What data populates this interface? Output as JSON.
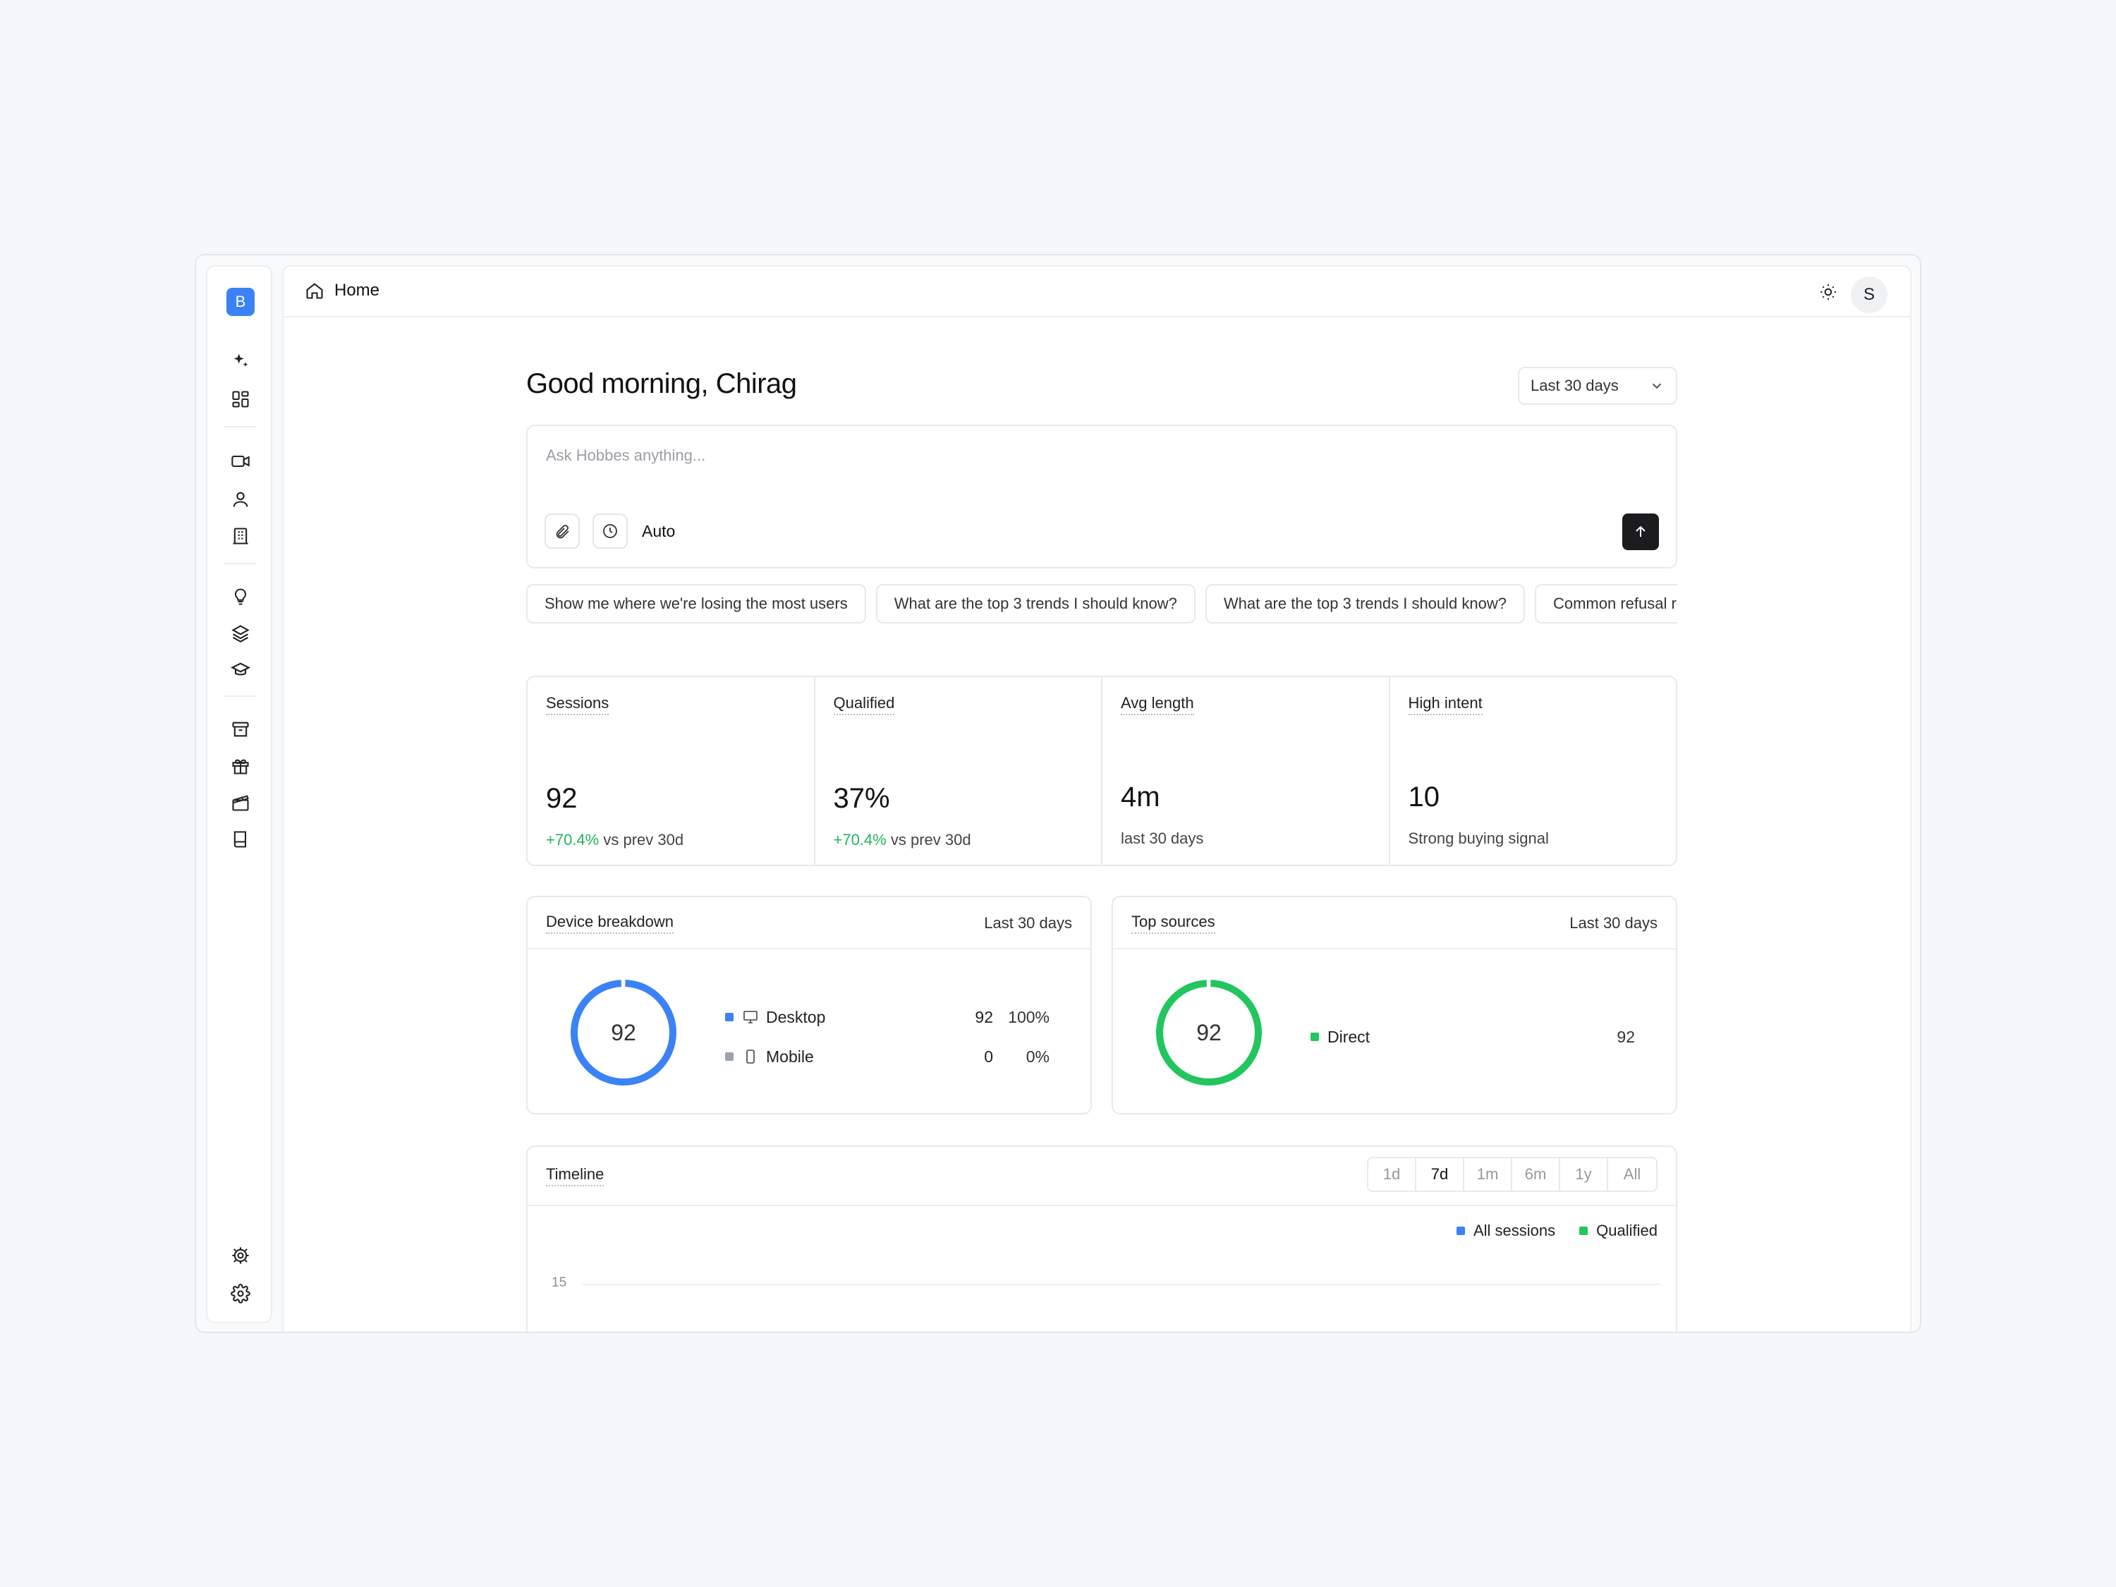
{
  "app": {
    "logo_letter": "B",
    "breadcrumb": "Home",
    "avatar_initial": "S"
  },
  "sidebar": {
    "icons": [
      "sparkles-icon",
      "dashboard-icon",
      "video-icon",
      "user-icon",
      "building-icon",
      "lightbulb-icon",
      "layers-icon",
      "graduation-cap-icon",
      "archive-icon",
      "gift-icon",
      "clapperboard-icon",
      "book-icon",
      "settings-gear-icon",
      "settings-icon"
    ]
  },
  "header": {
    "greeting": "Good morning, Chirag",
    "range_select": "Last 30 days"
  },
  "ask": {
    "placeholder": "Ask Hobbes anything...",
    "mode": "Auto"
  },
  "suggestions": [
    "Show me where we're losing the most users",
    "What are the top 3 trends I should know?",
    "What are the top 3 trends I should know?",
    "Common refusal reasons"
  ],
  "stats": [
    {
      "label": "Sessions",
      "value": "92",
      "delta": "+70.4%",
      "sub": " vs prev 30d"
    },
    {
      "label": "Qualified",
      "value": "37%",
      "delta": "+70.4%",
      "sub": " vs prev 30d"
    },
    {
      "label": "Avg length",
      "value": "4m",
      "delta": "",
      "sub": "last 30 days"
    },
    {
      "label": "High intent",
      "value": "10",
      "delta": "",
      "sub": "Strong buying signal"
    }
  ],
  "device_breakdown": {
    "title": "Device breakdown",
    "range": "Last 30 days",
    "total": "92",
    "accent": "#3b82f6",
    "rows": [
      {
        "name": "Desktop",
        "count": "92",
        "pct": "100%",
        "color": "#3b82f6"
      },
      {
        "name": "Mobile",
        "count": "0",
        "pct": "0%",
        "color": "#9ca3af"
      }
    ]
  },
  "top_sources": {
    "title": "Top sources",
    "range": "Last 30 days",
    "total": "92",
    "accent": "#22c55e",
    "rows": [
      {
        "name": "Direct",
        "count": "92",
        "color": "#22c55e"
      }
    ]
  },
  "timeline": {
    "title": "Timeline",
    "tabs": [
      "1d",
      "7d",
      "1m",
      "6m",
      "1y",
      "All"
    ],
    "active_tab": "7d",
    "legend": [
      {
        "name": "All sessions",
        "color": "#3b82f6"
      },
      {
        "name": "Qualified",
        "color": "#22c55e"
      }
    ],
    "y_tick": "15"
  }
}
